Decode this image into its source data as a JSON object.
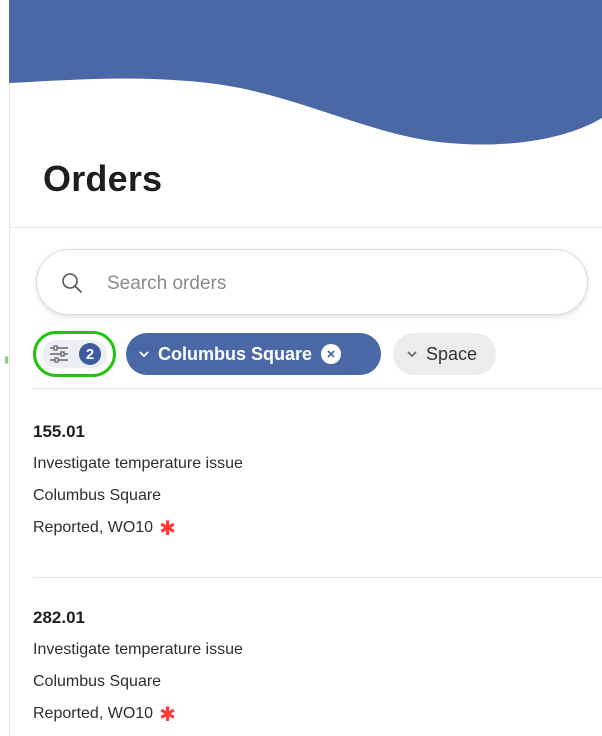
{
  "page": {
    "title": "Orders"
  },
  "search": {
    "placeholder": "Search orders",
    "value": ""
  },
  "filters": {
    "active_count": "2",
    "chips": [
      {
        "label": "Columbus Square",
        "active": true
      },
      {
        "label": "Space",
        "active": false
      }
    ]
  },
  "orders": [
    {
      "number": "155.01",
      "description": "Investigate temperature issue",
      "location": "Columbus Square",
      "status": "Reported, WO10"
    },
    {
      "number": "282.01",
      "description": "Investigate temperature issue",
      "location": "Columbus Square",
      "status": "Reported, WO10"
    }
  ],
  "colors": {
    "header": "#4a68a6",
    "chip_active": "#4a68a6",
    "highlight_ring": "#22c40f",
    "required_star": "#ff3b3b"
  }
}
